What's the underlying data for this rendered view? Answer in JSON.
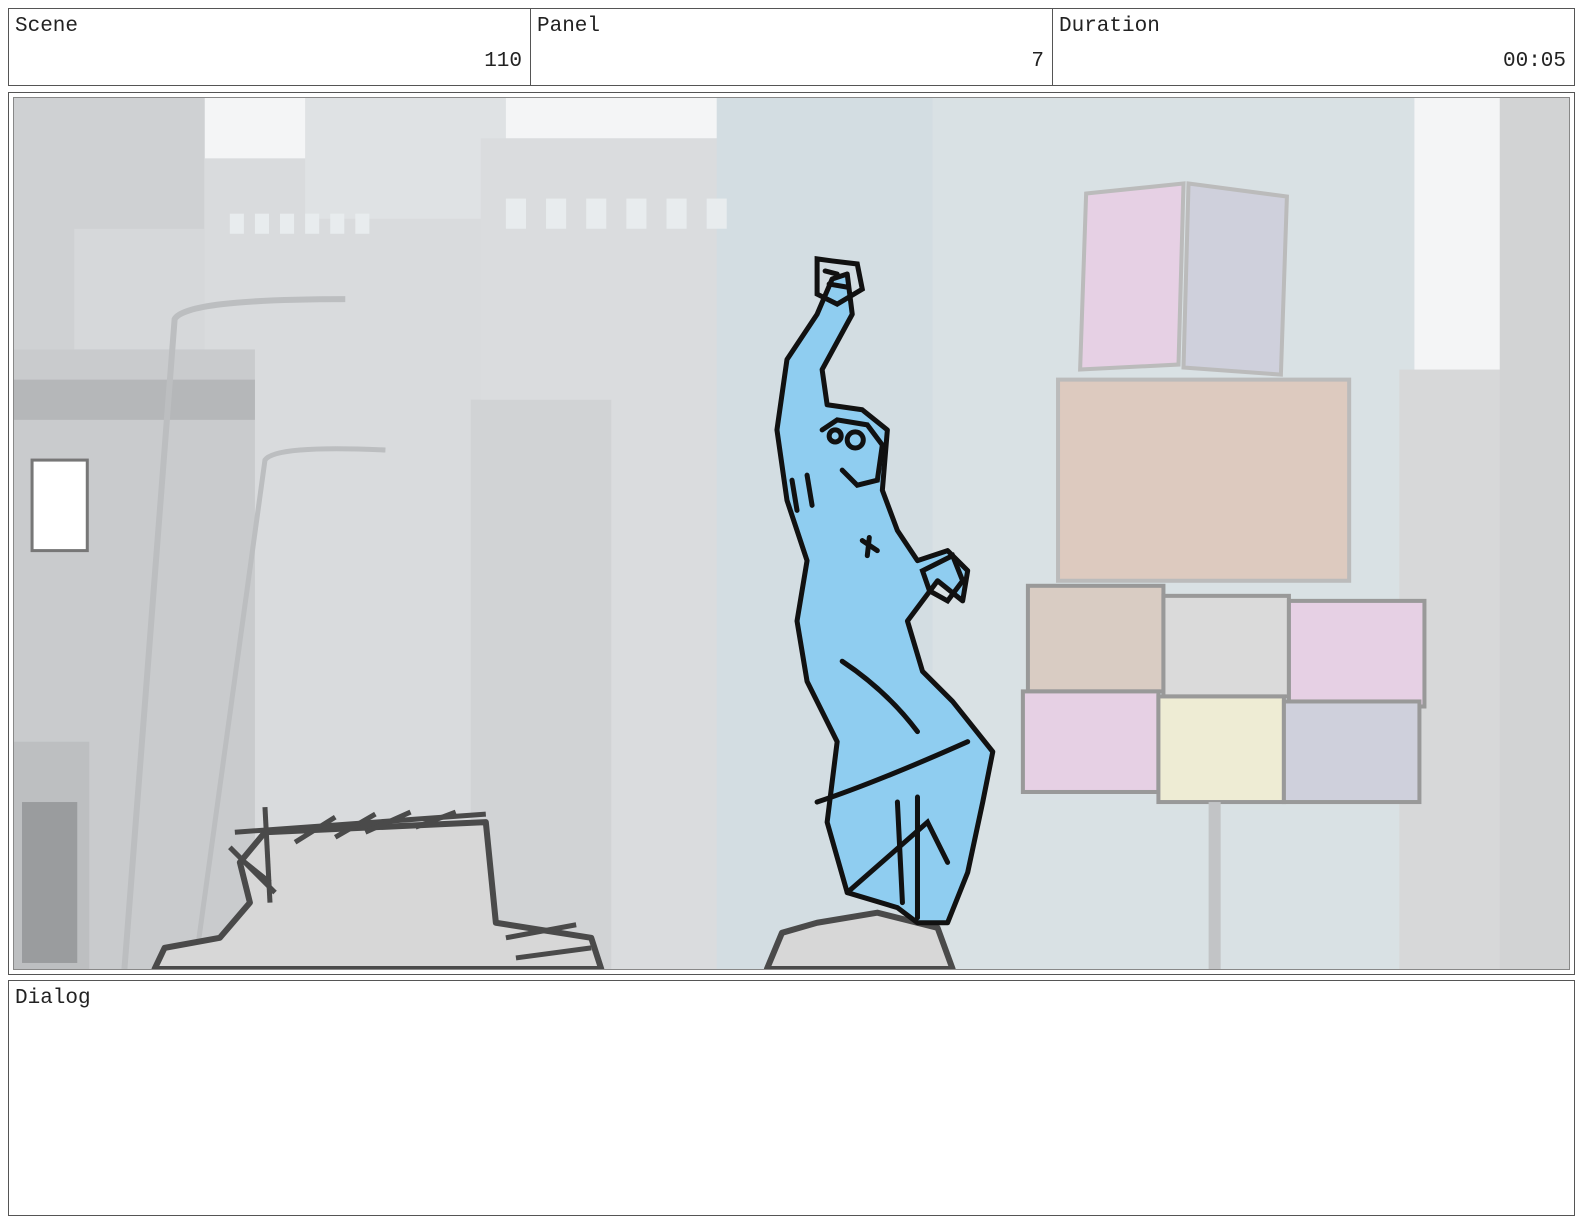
{
  "header": {
    "scene": {
      "label": "Scene",
      "value": "110"
    },
    "panel": {
      "label": "Panel",
      "value": "7"
    },
    "duration": {
      "label": "Duration",
      "value": "00:05"
    }
  },
  "artwork": {
    "description_icon": "storyboard-sketch-image",
    "colors": {
      "character_fill": "#8fcdf0",
      "ink": "#111111",
      "buildings": "#d4d6d8",
      "billboard_pink": "#e6d0e4",
      "billboard_lavender": "#cfd0dc",
      "billboard_tan": "#ddcabf",
      "billboard_cream": "#eeecd4"
    }
  },
  "dialog": {
    "label": "Dialog",
    "text": ""
  }
}
